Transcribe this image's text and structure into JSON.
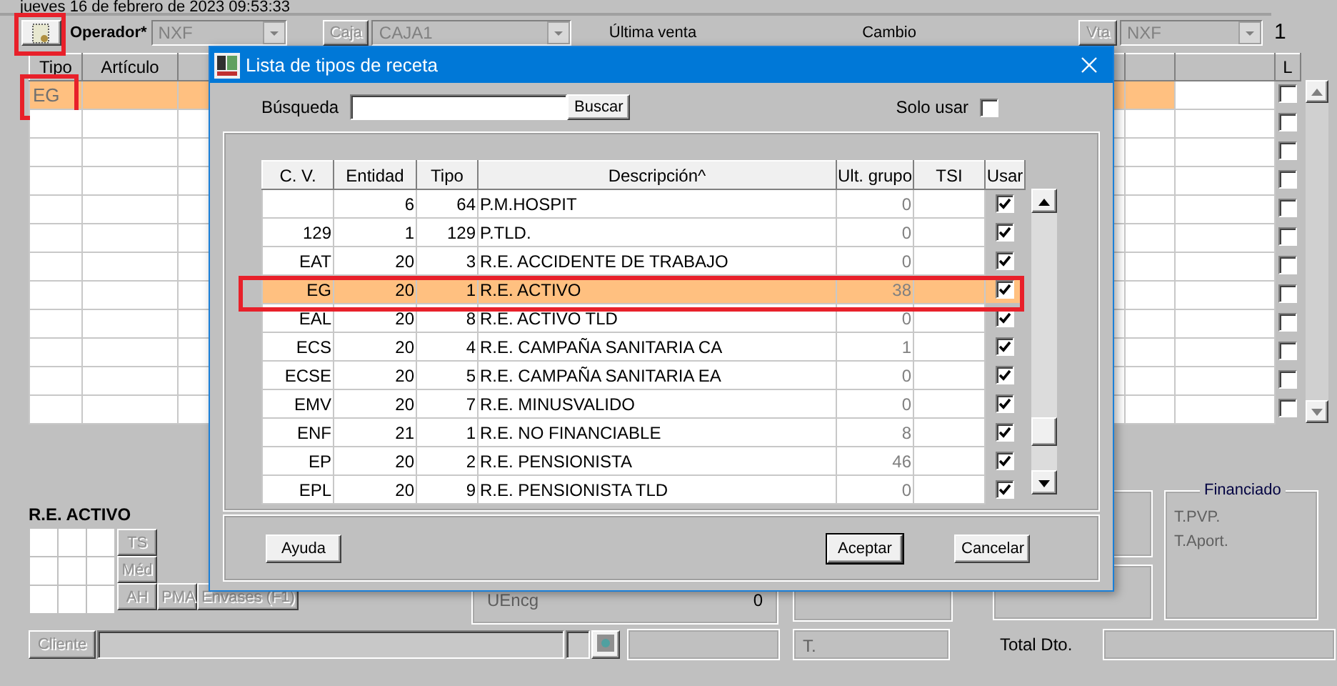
{
  "date": "jueves 16 de febrero de 2023 09:53:33",
  "toolbar": {
    "tool_button": {
      "highlighted": true
    },
    "operator_label": "Operador*",
    "operator_value": "NXF",
    "caja_button": "Caja",
    "caja_value": "CAJA1",
    "last_sale_label": "Última venta",
    "change_label": "Cambio",
    "vta_button": "Vta",
    "vta_value": "NXF",
    "counter": "1"
  },
  "sales_grid": {
    "columns": [
      "Tipo",
      "Artículo",
      "L"
    ],
    "rows": [
      {
        "tipo": "EG",
        "selected": true,
        "highlighted": true,
        "l_checked": false
      },
      {
        "selected": false,
        "highlighted": false,
        "l_checked": false
      },
      {
        "selected": false,
        "highlighted": false,
        "l_checked": false
      },
      {
        "selected": false,
        "highlighted": false,
        "l_checked": false
      },
      {
        "selected": false,
        "highlighted": false,
        "l_checked": false
      },
      {
        "selected": false,
        "highlighted": false,
        "l_checked": false
      },
      {
        "selected": false,
        "highlighted": false,
        "l_checked": false
      },
      {
        "selected": false,
        "highlighted": false,
        "l_checked": false
      },
      {
        "selected": false,
        "highlighted": false,
        "l_checked": false
      },
      {
        "selected": false,
        "highlighted": false,
        "l_checked": false
      },
      {
        "selected": false,
        "highlighted": false,
        "l_checked": false
      },
      {
        "selected": false,
        "highlighted": false,
        "l_checked": false
      }
    ]
  },
  "prescription": {
    "title": "R.E. ACTIVO",
    "buttons": [
      {
        "label": "TS",
        "disabled": true
      },
      {
        "label": "Méd",
        "disabled": true
      },
      {
        "label": "AH",
        "disabled": true
      },
      {
        "label": "PMA",
        "disabled": true
      },
      {
        "label": "Envases (F1)",
        "disabled": true
      }
    ]
  },
  "totals": {
    "uencg_label": "UEncg",
    "uencg_value": "0",
    "financed_title": "Financiado",
    "financed_labels": [
      "T.PVP.",
      "T.Aport."
    ],
    "t_label": "T.",
    "total_discount_label": "Total Dto."
  },
  "client": {
    "button": "Cliente"
  },
  "dialog": {
    "title": "Lista de tipos de receta",
    "search_label": "Búsqueda",
    "search_button": "Buscar",
    "only_use_label": "Solo usar",
    "only_use_checked": false,
    "columns": [
      "C. V.",
      "Entidad",
      "Tipo",
      "Descripción^",
      "Ult. grupo",
      "TSI",
      "Usar"
    ],
    "rows": [
      {
        "cv": "",
        "entidad": "6",
        "tipo": "64",
        "descripcion": "P.M.HOSPIT",
        "ult_grupo": "0",
        "usar": true,
        "selected": false,
        "highlighted": false
      },
      {
        "cv": "129",
        "entidad": "1",
        "tipo": "129",
        "descripcion": "P.TLD.",
        "ult_grupo": "0",
        "usar": true,
        "selected": false,
        "highlighted": false
      },
      {
        "cv": "EAT",
        "entidad": "20",
        "tipo": "3",
        "descripcion": "R.E. ACCIDENTE DE TRABAJO",
        "ult_grupo": "0",
        "usar": true,
        "selected": false,
        "highlighted": false
      },
      {
        "cv": "EG",
        "entidad": "20",
        "tipo": "1",
        "descripcion": "R.E. ACTIVO",
        "ult_grupo": "38",
        "usar": true,
        "selected": true,
        "highlighted": true
      },
      {
        "cv": "EAL",
        "entidad": "20",
        "tipo": "8",
        "descripcion": "R.E. ACTIVO TLD",
        "ult_grupo": "0",
        "usar": true,
        "selected": false,
        "highlighted": false
      },
      {
        "cv": "ECS",
        "entidad": "20",
        "tipo": "4",
        "descripcion": "R.E. CAMPAÑA SANITARIA CA",
        "ult_grupo": "1",
        "usar": true,
        "selected": false,
        "highlighted": false
      },
      {
        "cv": "ECSE",
        "entidad": "20",
        "tipo": "5",
        "descripcion": "R.E. CAMPAÑA SANITARIA EA",
        "ult_grupo": "0",
        "usar": true,
        "selected": false,
        "highlighted": false
      },
      {
        "cv": "EMV",
        "entidad": "20",
        "tipo": "7",
        "descripcion": "R.E. MINUSVALIDO",
        "ult_grupo": "0",
        "usar": true,
        "selected": false,
        "highlighted": false
      },
      {
        "cv": "ENF",
        "entidad": "21",
        "tipo": "1",
        "descripcion": "R.E. NO FINANCIABLE",
        "ult_grupo": "8",
        "usar": true,
        "selected": false,
        "highlighted": false
      },
      {
        "cv": "EP",
        "entidad": "20",
        "tipo": "2",
        "descripcion": "R.E. PENSIONISTA",
        "ult_grupo": "46",
        "usar": true,
        "selected": false,
        "highlighted": false
      },
      {
        "cv": "EPL",
        "entidad": "20",
        "tipo": "9",
        "descripcion": "R.E. PENSIONISTA TLD",
        "ult_grupo": "0",
        "usar": true,
        "selected": false,
        "highlighted": false
      }
    ],
    "buttons": [
      {
        "label": "Ayuda",
        "default": false
      },
      {
        "label": "Aceptar",
        "default": true
      },
      {
        "label": "Cancelar",
        "default": false
      }
    ]
  }
}
